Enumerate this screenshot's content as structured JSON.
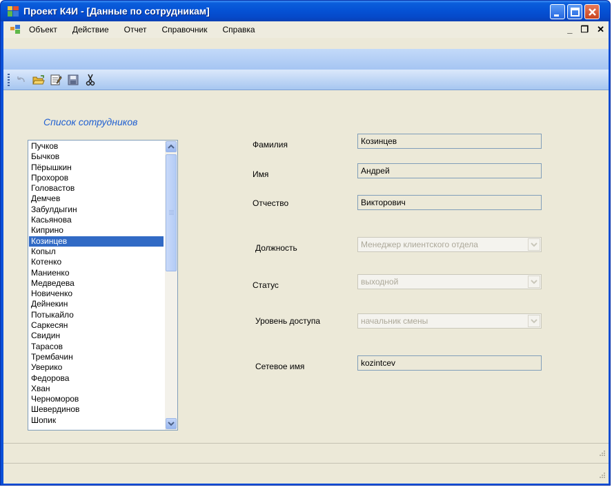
{
  "window": {
    "title": "Проект К4И - [Данные по сотрудникам]"
  },
  "menu": {
    "items": [
      "Объект",
      "Действие",
      "Отчет",
      "Справочник",
      "Справка"
    ]
  },
  "toolbar": {
    "icons": [
      "undo-icon",
      "open-folder-icon",
      "edit-icon",
      "save-icon",
      "cut-icon"
    ]
  },
  "employees": {
    "caption": "Список сотрудников",
    "selected": "Козинцев",
    "items": [
      "Пучков",
      "Бычков",
      "Пёрышкин",
      "Прохоров",
      "Головастов",
      "Демчев",
      "Забулдыгин",
      "Касьянова",
      "Киприно",
      "Козинцев",
      "Копыл",
      "Котенко",
      "Маниенко",
      "Медведева",
      "Новиченко",
      "Дейнекин",
      "Потыкайло",
      "Саркесян",
      "Свидин",
      "Тарасов",
      "Трембачин",
      "Уверико",
      "Федорова",
      "Хван",
      "Черноморов",
      "Шевердинов",
      "Шопик"
    ]
  },
  "form": {
    "surname_label": "Фамилия",
    "surname_value": "Козинцев",
    "name_label": "Имя",
    "name_value": "Андрей",
    "patronymic_label": "Отчество",
    "patronymic_value": "Викторович",
    "position_label": "Должность",
    "position_value": "Менеджер клиентского отдела",
    "status_label": "Статус",
    "status_value": "выходной",
    "access_label": "Уровень доступа",
    "access_value": "начальник смены",
    "netname_label": "Сетевое имя",
    "netname_value": "kozintcev"
  },
  "colors": {
    "titlebar": "#0551d4",
    "selection": "#316ac5",
    "caption": "#1f5fd1",
    "background": "#ece9d8"
  }
}
